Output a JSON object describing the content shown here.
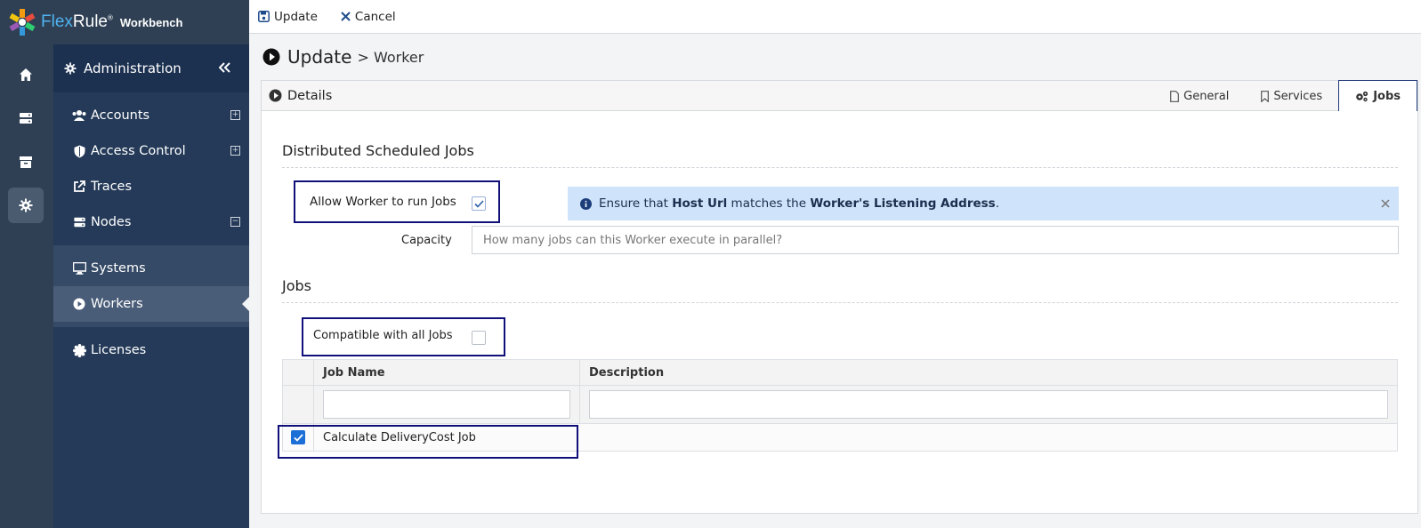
{
  "brand": {
    "name_prefix": "Flex",
    "name_suffix": "Rule",
    "reg": "®",
    "product": "Workbench"
  },
  "toolbar": {
    "update_label": "Update",
    "cancel_label": "Cancel"
  },
  "sidebar": {
    "section_title": "Administration",
    "items": [
      {
        "label": "Accounts",
        "icon": "users-icon",
        "expander": "+"
      },
      {
        "label": "Access Control",
        "icon": "shield-icon",
        "expander": "+"
      },
      {
        "label": "Traces",
        "icon": "external-link-icon"
      },
      {
        "label": "Nodes",
        "icon": "server-icon",
        "expander": "−"
      },
      {
        "label": "Systems",
        "icon": "monitor-icon"
      },
      {
        "label": "Workers",
        "icon": "play-circle-icon"
      },
      {
        "label": "Licenses",
        "icon": "certificate-icon"
      }
    ]
  },
  "page": {
    "title_main": "Update",
    "title_sep": ">",
    "title_sub": "Worker"
  },
  "panel": {
    "title": "Details",
    "tabs": [
      {
        "label": "General",
        "icon": "file-icon"
      },
      {
        "label": "Services",
        "icon": "bookmark-icon"
      },
      {
        "label": "Jobs",
        "icon": "cogs-icon",
        "active": true
      }
    ]
  },
  "scheduled": {
    "section_title": "Distributed Scheduled Jobs",
    "allow_label": "Allow Worker to run Jobs",
    "allow_checked": true,
    "info_pre": "Ensure that ",
    "info_host": "Host Url",
    "info_mid": " matches the ",
    "info_addr": "Worker's Listening Address",
    "info_post": ".",
    "capacity_label": "Capacity",
    "capacity_placeholder": "How many jobs can this Worker execute in parallel?"
  },
  "jobs": {
    "section_title": "Jobs",
    "compatible_label": "Compatible with all Jobs",
    "compatible_checked": false,
    "columns": [
      "Job Name",
      "Description"
    ],
    "rows": [
      {
        "name": "Calculate DeliveryCost Job",
        "description": "",
        "checked": true
      }
    ]
  },
  "colors": {
    "rail": "#2f4054",
    "sidebar": "#243a58",
    "highlight": "#10107a",
    "info_bg": "#cfe3fb",
    "checkbox": "#1d6fd8"
  }
}
